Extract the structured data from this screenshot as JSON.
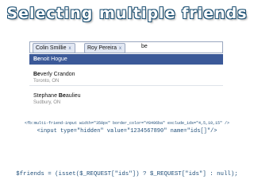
{
  "title": "Selecting multiple friends",
  "widget": {
    "tokens": [
      {
        "label": "Colin Smillie",
        "remove": "x"
      },
      {
        "label": "Roy Pereira",
        "remove": "x"
      }
    ],
    "typed": "be",
    "results": [
      {
        "match": "Be",
        "rest": "noit Hogue",
        "location": ""
      },
      {
        "match": "Be",
        "rest": "verly Crandon",
        "location": "Toronto, ON"
      },
      {
        "before": "Stephane ",
        "match": "Be",
        "rest": "aulieu",
        "location": "Sudbury, ON"
      }
    ]
  },
  "code": {
    "tag": "<fb:multi-friend-input width=\"350px\" border_color=\"#8496ba\" exclude_ids=\"4,5,10,15\" />",
    "hidden_input": "<input type=\"hidden\" value=\"1234567890\" name=\"ids[]\"/>",
    "php": "$friends = (isset($_REQUEST[\"ids\"]) ? $_REQUEST[\"ids\"] : null);"
  },
  "colors": {
    "title_fill": "#ffffff",
    "title_outline": "#1b4f72",
    "highlight": "#3b5998",
    "code_text": "#1f4e79"
  }
}
